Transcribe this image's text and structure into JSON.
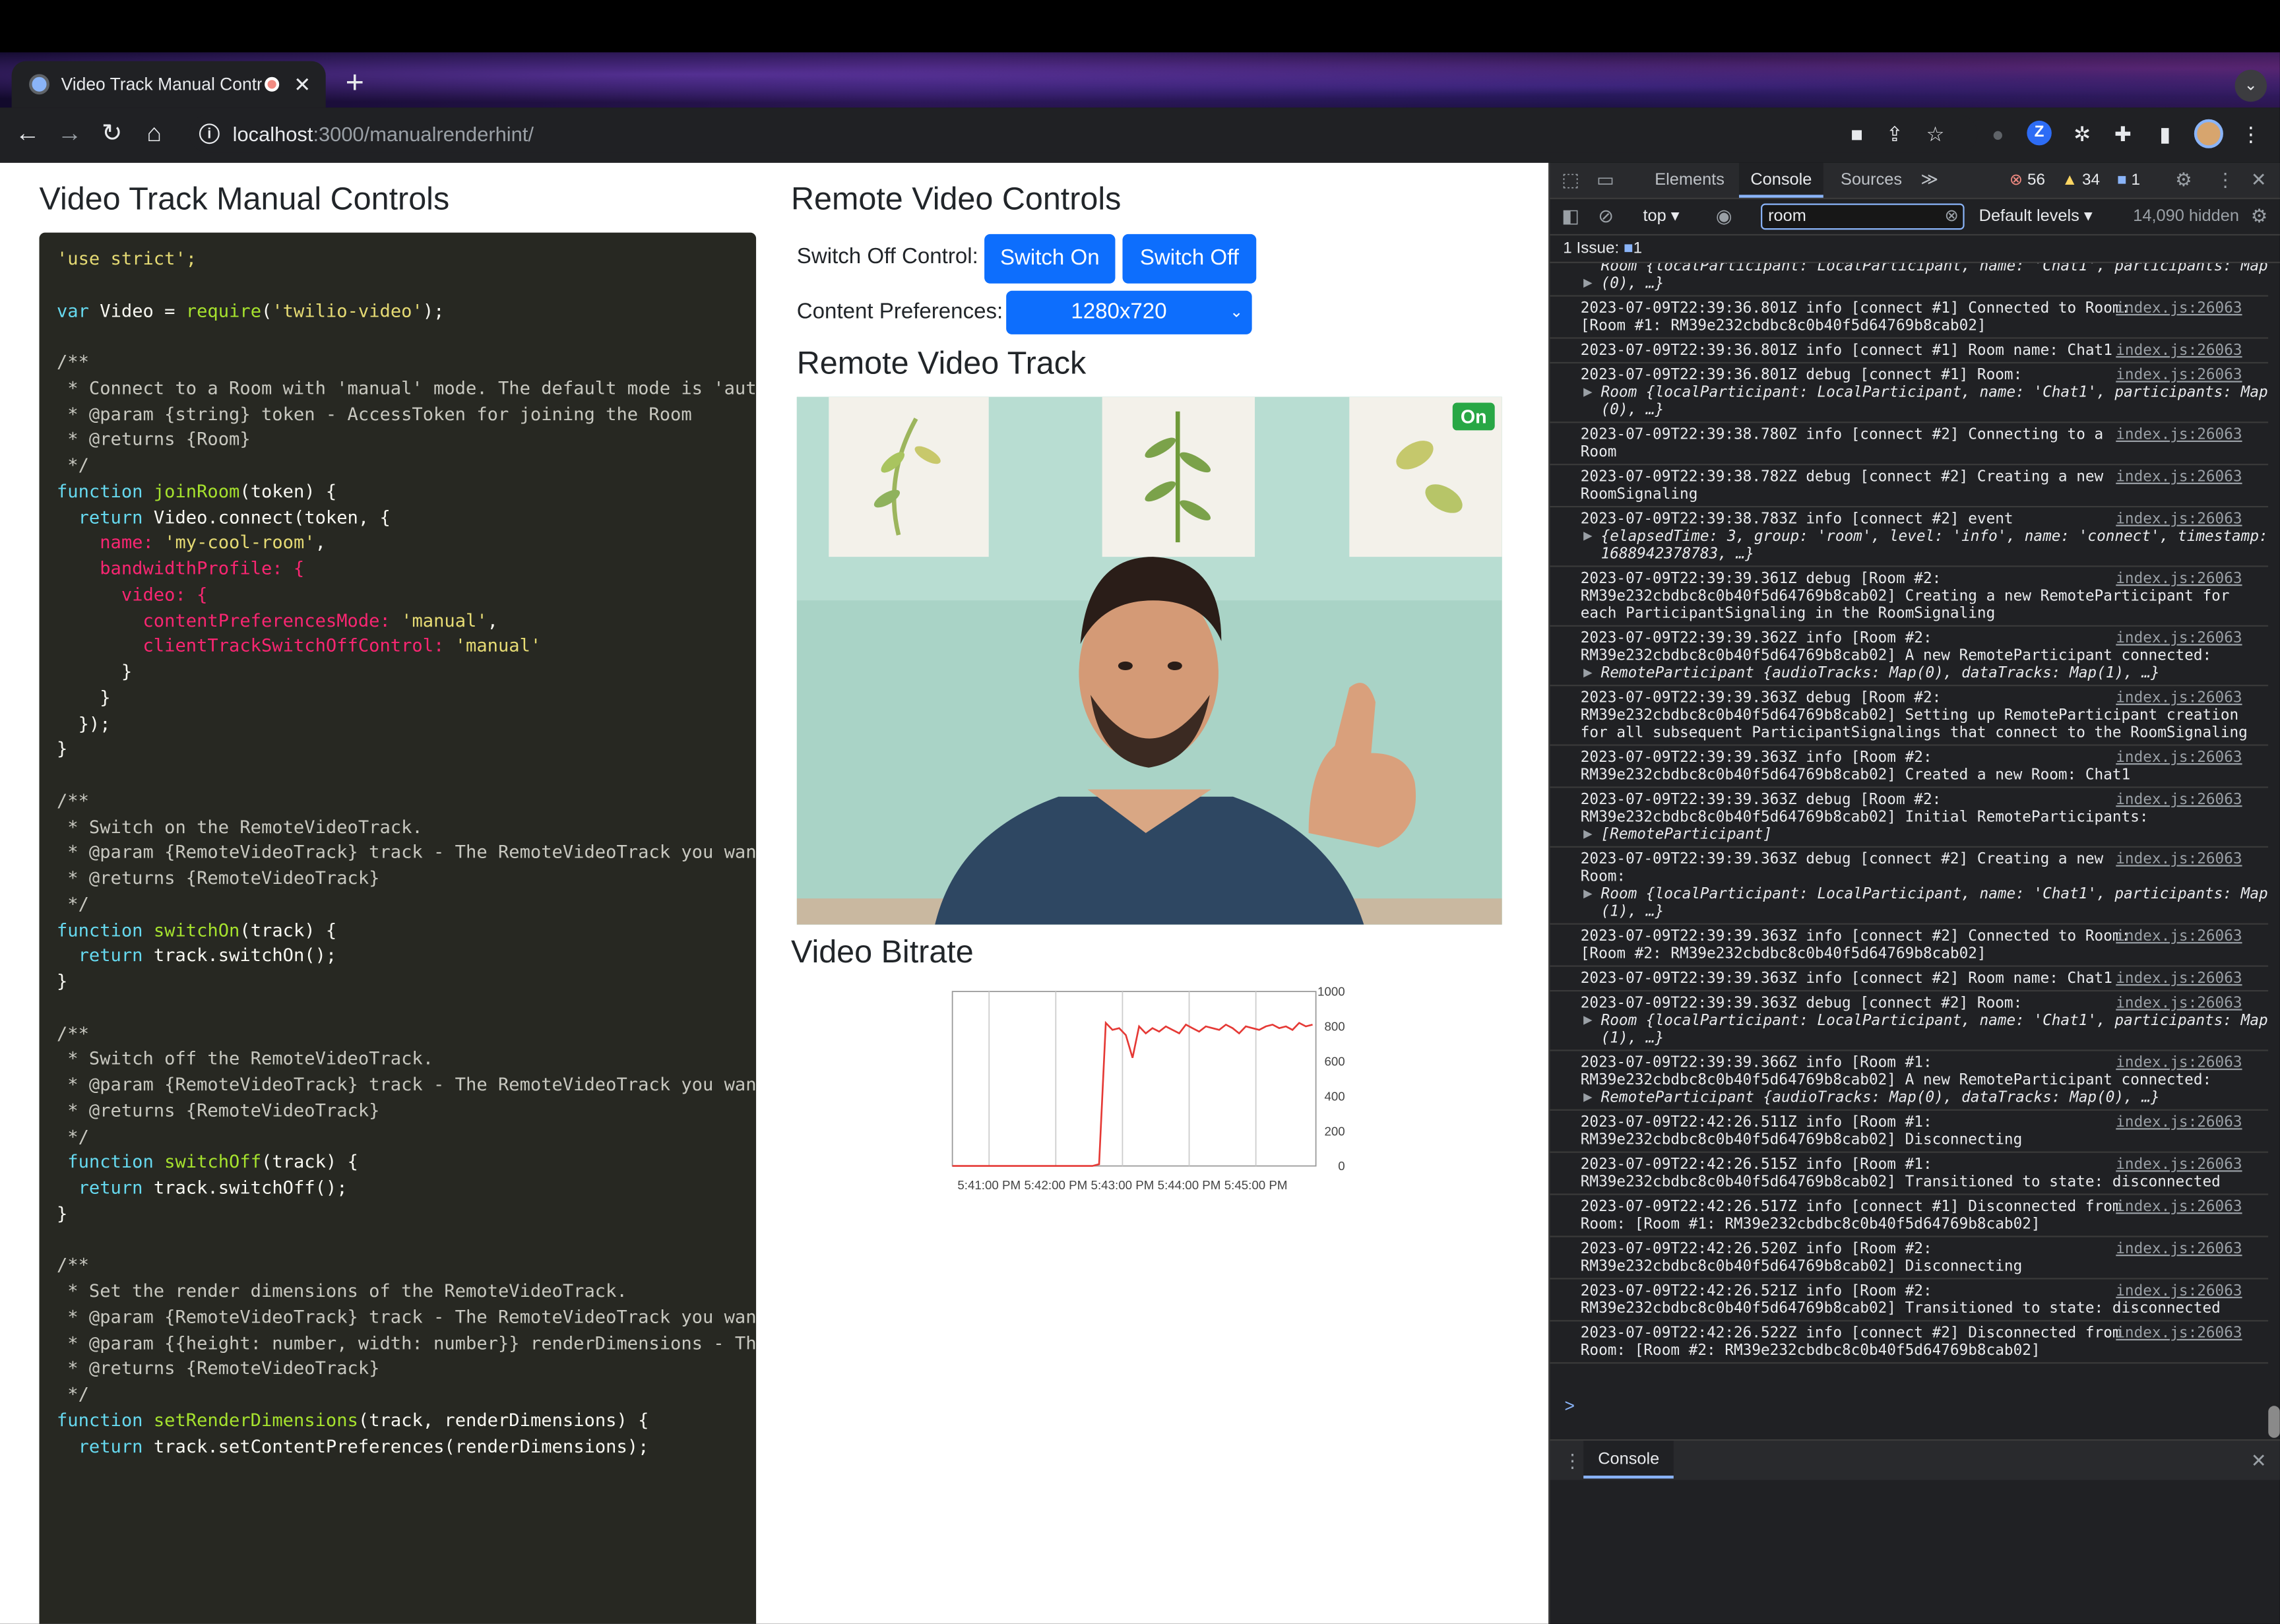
{
  "browser": {
    "tab_title": "Video Track Manual Contro",
    "tab_close": "✕",
    "new_tab": "+",
    "url_host": "localhost",
    "url_path": ":3000/manualrenderhint/"
  },
  "page": {
    "title": "Video Track Manual Controls",
    "code_lines": [
      [
        [
          "'use strict';",
          "str"
        ]
      ],
      [],
      [
        [
          "var ",
          "kw"
        ],
        [
          "Video = ",
          ""
        ],
        [
          "require",
          "fn"
        ],
        [
          "(",
          ""
        ],
        [
          "'twilio-video'",
          "str"
        ],
        [
          ");",
          ""
        ]
      ],
      [],
      [
        [
          "/**",
          "com"
        ]
      ],
      [
        [
          " * Connect to a Room with 'manual' mode. The default mode is 'auto'.",
          "com"
        ]
      ],
      [
        [
          " * @param {string} token - AccessToken for joining the Room",
          "com"
        ]
      ],
      [
        [
          " * @returns {Room}",
          "com"
        ]
      ],
      [
        [
          " */",
          "com"
        ]
      ],
      [
        [
          "function ",
          "kw"
        ],
        [
          "joinRoom",
          "fn"
        ],
        [
          "(token) {",
          ""
        ]
      ],
      [
        [
          "  return ",
          "kw"
        ],
        [
          "Video.connect(token, {",
          ""
        ]
      ],
      [
        [
          "    name: ",
          "prop"
        ],
        [
          "'my-cool-room'",
          "str"
        ],
        [
          ",",
          ""
        ]
      ],
      [
        [
          "    bandwidthProfile: {",
          "prop"
        ]
      ],
      [
        [
          "      video: {",
          "prop"
        ]
      ],
      [
        [
          "        contentPreferencesMode: ",
          "prop"
        ],
        [
          "'manual'",
          "str"
        ],
        [
          ",",
          ""
        ]
      ],
      [
        [
          "        clientTrackSwitchOffControl: ",
          "prop"
        ],
        [
          "'manual'",
          "str"
        ]
      ],
      [
        [
          "      }",
          ""
        ]
      ],
      [
        [
          "    }",
          ""
        ]
      ],
      [
        [
          "  });",
          ""
        ]
      ],
      [
        [
          "}",
          ""
        ]
      ],
      [],
      [
        [
          "/**",
          "com"
        ]
      ],
      [
        [
          " * Switch on the RemoteVideoTrack.",
          "com"
        ]
      ],
      [
        [
          " * @param {RemoteVideoTrack} track - The RemoteVideoTrack you want t",
          "com"
        ]
      ],
      [
        [
          " * @returns {RemoteVideoTrack}",
          "com"
        ]
      ],
      [
        [
          " */",
          "com"
        ]
      ],
      [
        [
          "function ",
          "kw"
        ],
        [
          "switchOn",
          "fn"
        ],
        [
          "(track) {",
          ""
        ]
      ],
      [
        [
          "  return ",
          "kw"
        ],
        [
          "track.switchOn();",
          ""
        ]
      ],
      [
        [
          "}",
          ""
        ]
      ],
      [],
      [
        [
          "/**",
          "com"
        ]
      ],
      [
        [
          " * Switch off the RemoteVideoTrack.",
          "com"
        ]
      ],
      [
        [
          " * @param {RemoteVideoTrack} track - The RemoteVideoTrack you want t",
          "com"
        ]
      ],
      [
        [
          " * @returns {RemoteVideoTrack}",
          "com"
        ]
      ],
      [
        [
          " */",
          "com"
        ]
      ],
      [
        [
          " function ",
          "kw"
        ],
        [
          "switchOff",
          "fn"
        ],
        [
          "(track) {",
          ""
        ]
      ],
      [
        [
          "  return ",
          "kw"
        ],
        [
          "track.switchOff();",
          ""
        ]
      ],
      [
        [
          "}",
          ""
        ]
      ],
      [],
      [
        [
          "/**",
          "com"
        ]
      ],
      [
        [
          " * Set the render dimensions of the RemoteVideoTrack.",
          "com"
        ]
      ],
      [
        [
          " * @param {RemoteVideoTrack} track - The RemoteVideoTrack you want t",
          "com"
        ]
      ],
      [
        [
          " * @param {{height: number, width: number}} renderDimensions - The r",
          "com"
        ]
      ],
      [
        [
          " * @returns {RemoteVideoTrack}",
          "com"
        ]
      ],
      [
        [
          " */",
          "com"
        ]
      ],
      [
        [
          "function ",
          "kw"
        ],
        [
          "setRenderDimensions",
          "fn"
        ],
        [
          "(track, renderDimensions) {",
          ""
        ]
      ],
      [
        [
          "  return ",
          "kw"
        ],
        [
          "track.setContentPreferences(renderDimensions);",
          ""
        ]
      ]
    ],
    "remote_controls_title": "Remote Video Controls",
    "switch_off_control_label": "Switch Off Control:",
    "switch_on_label": "Switch On",
    "switch_off_label": "Switch Off",
    "content_preferences_label": "Content Preferences:",
    "content_preferences_value": "1280x720",
    "remote_track_title": "Remote Video Track",
    "track_state_badge": "On",
    "video_bitrate_title": "Video Bitrate"
  },
  "chart_data": {
    "type": "line",
    "title": "",
    "xlabel": "",
    "ylabel": "",
    "ylim": [
      0,
      1000
    ],
    "y_ticks": [
      "1000",
      "800",
      "600",
      "400",
      "200",
      "0"
    ],
    "x_ticks": [
      "5:41:00 PM",
      "5:42:00 PM",
      "5:43:00 PM",
      "5:44:00 PM",
      "5:45:00 PM"
    ],
    "series": [
      {
        "color": "#e53935",
        "x_minutes": [
          0,
          0.5,
          1,
          1.5,
          2,
          2.1,
          2.2,
          2.3,
          2.4,
          2.5,
          2.6,
          2.7,
          2.8,
          2.9,
          3.0,
          3.1,
          3.2,
          3.3,
          3.4,
          3.5,
          3.6,
          3.7,
          3.8,
          3.9,
          4.0,
          4.1,
          4.2,
          4.3,
          4.4,
          4.5,
          4.6,
          4.7,
          4.8,
          4.9,
          5.0,
          5.1,
          5.2,
          5.3,
          5.4
        ],
        "values": [
          0,
          0,
          0,
          0,
          0,
          0,
          10,
          820,
          780,
          790,
          750,
          620,
          800,
          760,
          790,
          770,
          800,
          780,
          760,
          810,
          790,
          770,
          800,
          790,
          780,
          810,
          790,
          760,
          800,
          790,
          780,
          800,
          810,
          790,
          800,
          780,
          820,
          800,
          810
        ]
      }
    ],
    "grid": true
  },
  "devtools": {
    "tabs": [
      "Elements",
      "Console",
      "Sources",
      "≫"
    ],
    "errors_count": "56",
    "warnings_count": "34",
    "info_count": "1",
    "context": "top ▾",
    "filter_value": "room",
    "levels": "Default levels ▾",
    "hidden": "14,090 hidden",
    "issues_label": "1 Issue:",
    "issues_count": "1",
    "source_link": "index.js:26063",
    "log": [
      {
        "lines": [
          "Room {localParticipant: LocalParticipant, name: 'Chat1', participants: Map",
          "(0), …}"
        ],
        "obj": true,
        "top_partial": true
      },
      {
        "lines": [
          "2023-07-09T22:39:36.801Z info [connect #1] Connected to Room:",
          "[Room #1: RM39e232cbdbc8c0b40f5d64769b8cab02]"
        ],
        "src": true
      },
      {
        "lines": [
          "2023-07-09T22:39:36.801Z info [connect #1] Room name: Chat1"
        ],
        "src": true
      },
      {
        "lines": [
          "2023-07-09T22:39:36.801Z debug [connect #1] Room:"
        ],
        "obj_lines": [
          "Room {localParticipant: LocalParticipant, name: 'Chat1', participants: Map",
          "(0), …}"
        ],
        "src": true
      },
      {
        "lines": [
          "2023-07-09T22:39:38.780Z info [connect #2] Connecting to a",
          "Room"
        ],
        "src": true
      },
      {
        "lines": [
          "2023-07-09T22:39:38.782Z debug [connect #2] Creating a new",
          "RoomSignaling"
        ],
        "src": true
      },
      {
        "lines": [
          "2023-07-09T22:39:38.783Z info [connect #2] event"
        ],
        "obj_lines": [
          "{elapsedTime: 3, group: 'room', level: 'info', name: 'connect', timestamp:",
          "1688942378783, …}"
        ],
        "src": true
      },
      {
        "lines": [
          "2023-07-09T22:39:39.361Z debug [Room #2:",
          "RM39e232cbdbc8c0b40f5d64769b8cab02] Creating a new RemoteParticipant for",
          "each ParticipantSignaling in the RoomSignaling"
        ],
        "src": true
      },
      {
        "lines": [
          "2023-07-09T22:39:39.362Z info [Room #2:",
          "RM39e232cbdbc8c0b40f5d64769b8cab02] A new RemoteParticipant connected:"
        ],
        "obj_lines": [
          "RemoteParticipant {audioTracks: Map(0), dataTracks: Map(1), …}"
        ],
        "src": true
      },
      {
        "lines": [
          "2023-07-09T22:39:39.363Z debug [Room #2:",
          "RM39e232cbdbc8c0b40f5d64769b8cab02] Setting up RemoteParticipant creation",
          "for all subsequent ParticipantSignalings that connect to the RoomSignaling"
        ],
        "src": true
      },
      {
        "lines": [
          "2023-07-09T22:39:39.363Z info [Room #2:",
          "RM39e232cbdbc8c0b40f5d64769b8cab02] Created a new Room: Chat1"
        ],
        "src": true
      },
      {
        "lines": [
          "2023-07-09T22:39:39.363Z debug [Room #2:",
          "RM39e232cbdbc8c0b40f5d64769b8cab02] Initial RemoteParticipants:"
        ],
        "obj_lines": [
          "[RemoteParticipant]"
        ],
        "src": true
      },
      {
        "lines": [
          "2023-07-09T22:39:39.363Z debug [connect #2] Creating a new",
          "Room:"
        ],
        "obj_lines": [
          "Room {localParticipant: LocalParticipant, name: 'Chat1', participants: Map",
          "(1), …}"
        ],
        "src": true
      },
      {
        "lines": [
          "2023-07-09T22:39:39.363Z info [connect #2] Connected to Room:",
          "[Room #2: RM39e232cbdbc8c0b40f5d64769b8cab02]"
        ],
        "src": true
      },
      {
        "lines": [
          "2023-07-09T22:39:39.363Z info [connect #2] Room name: Chat1"
        ],
        "src": true
      },
      {
        "lines": [
          "2023-07-09T22:39:39.363Z debug [connect #2] Room:"
        ],
        "obj_lines": [
          "Room {localParticipant: LocalParticipant, name: 'Chat1', participants: Map",
          "(1), …}"
        ],
        "src": true
      },
      {
        "lines": [
          "2023-07-09T22:39:39.366Z info [Room #1:",
          "RM39e232cbdbc8c0b40f5d64769b8cab02] A new RemoteParticipant connected:"
        ],
        "obj_lines": [
          "RemoteParticipant {audioTracks: Map(0), dataTracks: Map(0), …}"
        ],
        "src": true
      },
      {
        "lines": [
          "2023-07-09T22:42:26.511Z info [Room #1:",
          "RM39e232cbdbc8c0b40f5d64769b8cab02] Disconnecting"
        ],
        "src": true
      },
      {
        "lines": [
          "2023-07-09T22:42:26.515Z info [Room #1:",
          "RM39e232cbdbc8c0b40f5d64769b8cab02] Transitioned to state: disconnected"
        ],
        "src": true
      },
      {
        "lines": [
          "2023-07-09T22:42:26.517Z info [connect #1] Disconnected from",
          "Room: [Room #1: RM39e232cbdbc8c0b40f5d64769b8cab02]"
        ],
        "src": true
      },
      {
        "lines": [
          "2023-07-09T22:42:26.520Z info [Room #2:",
          "RM39e232cbdbc8c0b40f5d64769b8cab02] Disconnecting"
        ],
        "src": true
      },
      {
        "lines": [
          "2023-07-09T22:42:26.521Z info [Room #2:",
          "RM39e232cbdbc8c0b40f5d64769b8cab02] Transitioned to state: disconnected"
        ],
        "src": true
      },
      {
        "lines": [
          "2023-07-09T22:42:26.522Z info [connect #2] Disconnected from",
          "Room: [Room #2: RM39e232cbdbc8c0b40f5d64769b8cab02]"
        ],
        "src": true
      }
    ],
    "prompt": ">",
    "drawer_tab": "Console"
  }
}
